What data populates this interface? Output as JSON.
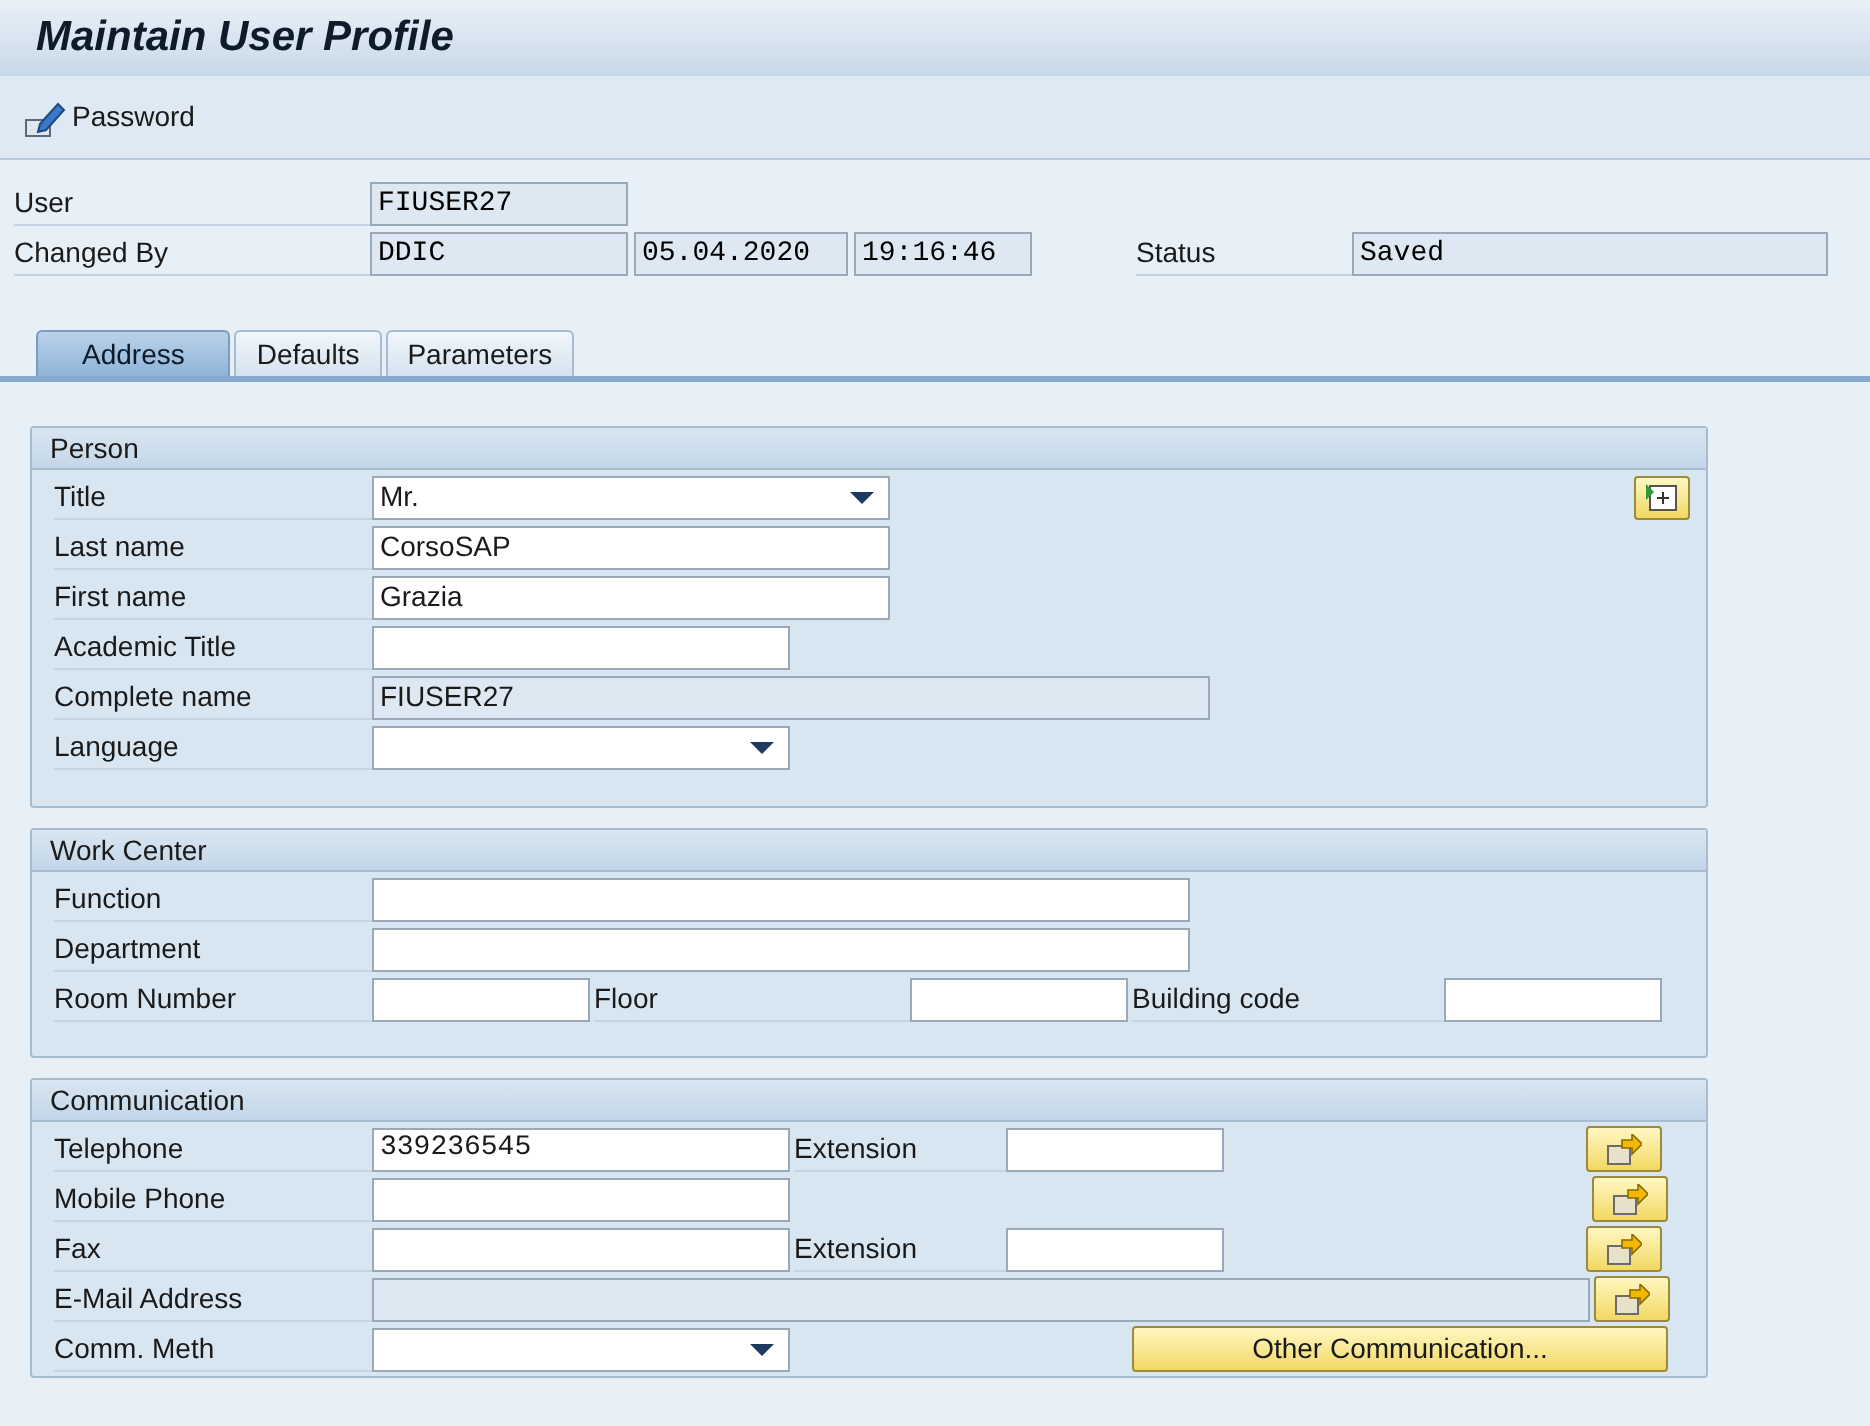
{
  "window": {
    "title": "Maintain User Profile"
  },
  "toolbar": [
    {
      "label": "Password"
    }
  ],
  "header": {
    "user": {
      "label": "User",
      "value": "FIUSER27"
    },
    "changed_by": {
      "label": "Changed By",
      "values": [
        "DDIC",
        "05.04.2020",
        "19:16:46"
      ]
    },
    "status": {
      "label": "Status",
      "value": "Saved"
    }
  },
  "tabs": [
    {
      "label": "Address",
      "selected": true
    },
    {
      "label": "Defaults",
      "selected": false
    },
    {
      "label": "Parameters",
      "selected": false
    }
  ],
  "person": {
    "title": "Person",
    "rows": [
      {
        "label": "Title",
        "kind": "dropdown",
        "value": "Mr."
      },
      {
        "label": "Last name",
        "kind": "input",
        "value": "CorsoSAP"
      },
      {
        "label": "First name",
        "kind": "input",
        "value": "Grazia"
      },
      {
        "label": "Academic Title",
        "kind": "input"
      },
      {
        "label": "Complete name",
        "kind": "readonly",
        "value": "FIUSER27"
      },
      {
        "label": "Language",
        "kind": "dropdown"
      }
    ]
  },
  "work_center": {
    "title": "Work Center",
    "function": {
      "label": "Function"
    },
    "department": {
      "label": "Department"
    },
    "room_number": {
      "label": "Room Number"
    },
    "floor": {
      "label": "Floor"
    },
    "building_code": {
      "label": "Building code"
    }
  },
  "communication": {
    "title": "Communication",
    "telephone": {
      "label": "Telephone",
      "value": "339236545",
      "extension_label": "Extension"
    },
    "mobile_phone": {
      "label": "Mobile Phone"
    },
    "fax": {
      "label": "Fax",
      "extension_label": "Extension"
    },
    "email": {
      "label": "E-Mail Address"
    },
    "comm_method": {
      "label": "Comm. Meth"
    },
    "other_button": "Other Communication..."
  }
}
